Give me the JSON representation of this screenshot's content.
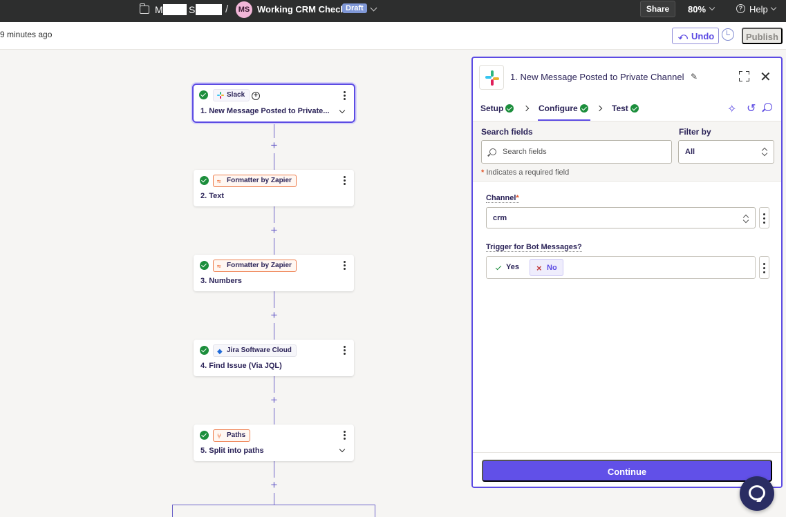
{
  "topbar": {
    "breadcrumb_part1": "M",
    "breadcrumb_part2": "S",
    "breadcrumb_separator": "/",
    "avatar_initials": "MS",
    "zap_title": "Working CRM Check",
    "status_badge": "Draft",
    "share_label": "Share",
    "zoom_level": "80%",
    "help_label": "Help"
  },
  "subbar": {
    "saved_text": "9 minutes ago",
    "undo_label": "Undo",
    "publish_label": "Publish"
  },
  "steps": [
    {
      "app": "Slack",
      "title": "1. New Message Posted to Private..."
    },
    {
      "app": "Formatter by Zapier",
      "title": "2. Text"
    },
    {
      "app": "Formatter by Zapier",
      "title": "3. Numbers"
    },
    {
      "app": "Jira Software Cloud",
      "title": "4. Find Issue (Via JQL)"
    },
    {
      "app": "Paths",
      "title": "5. Split into paths"
    }
  ],
  "panel": {
    "title": "1. New Message Posted to Private Channel",
    "tabs": [
      {
        "label": "Setup"
      },
      {
        "label": "Configure"
      },
      {
        "label": "Test"
      }
    ],
    "search_label": "Search fields",
    "search_placeholder": "Search fields",
    "filter_label": "Filter by",
    "filter_value": "All",
    "required_note": "Indicates a required field",
    "required_marker": "*",
    "fields": {
      "channel_label": "Channel",
      "channel_value": "crm",
      "bot_label": "Trigger for Bot Messages?",
      "yes_label": "Yes",
      "no_label": "No"
    },
    "continue_label": "Continue"
  },
  "colors": {
    "accent": "#5c4be3",
    "success": "#1c8e3c",
    "formatter_orange": "#ee7f4f",
    "topbar_bg": "#2d2e2e"
  },
  "icons": {
    "folder": "folder-icon",
    "slack": "slack-logo-icon",
    "formatter": "formatter-icon",
    "jira": "jira-icon",
    "paths": "paths-icon",
    "chat": "chat-icon"
  }
}
